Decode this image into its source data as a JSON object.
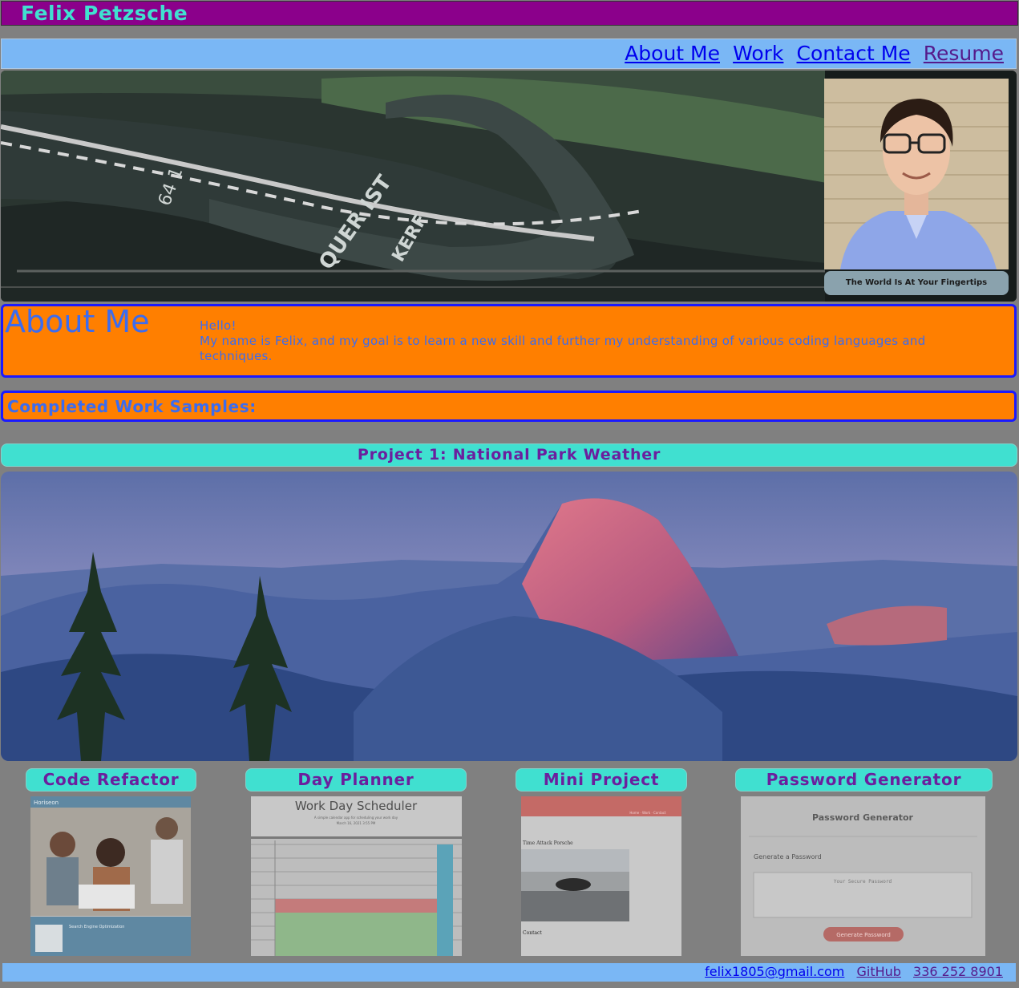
{
  "header": {
    "name": "Felix Petzsche"
  },
  "nav": {
    "about": "About Me",
    "work": "Work",
    "contact": "Contact Me",
    "resume": "Resume"
  },
  "hero": {
    "caption": "The World Is At Your Fingertips"
  },
  "about": {
    "heading": "About Me",
    "greeting": "Hello!",
    "body": "My name is Felix, and my goal is to learn a new skill and further my understanding of various coding languages and techniques."
  },
  "work": {
    "heading": "Completed Work Samples:",
    "featured": "Project 1: National Park Weather",
    "projects": [
      {
        "label": "Code Refactor",
        "thumb_title": "Horiseon",
        "thumb_text": "Search Engine Optimization"
      },
      {
        "label": "Day Planner",
        "thumb_title": "Work Day Scheduler",
        "thumb_sub": "A simple calendar app for scheduling your work day",
        "thumb_date": "March 16, 2021 3:55 PM"
      },
      {
        "label": "Mini Project",
        "thumb_title": "Time Attack Porsche",
        "thumb_nav": "Home · Work · Contact",
        "thumb_contact": "Contact"
      },
      {
        "label": "Password Generator",
        "thumb_title": "Password Generator",
        "thumb_sub": "Generate a Password",
        "thumb_placeholder": "Your Secure Password",
        "thumb_button": "Generate Password"
      }
    ]
  },
  "footer": {
    "email": "felix1805@gmail.com",
    "github": "GitHub",
    "phone": "336 252 8901"
  },
  "colors": {
    "header_bg": "#8b008b",
    "name_color": "#40e0d0",
    "nav_bg": "#7ab7f5",
    "section_bg": "#ff7f00",
    "section_border": "#1a1aff",
    "teal": "#40e0d0",
    "purple_text": "#6b1f9e",
    "page_bg": "#808080"
  }
}
